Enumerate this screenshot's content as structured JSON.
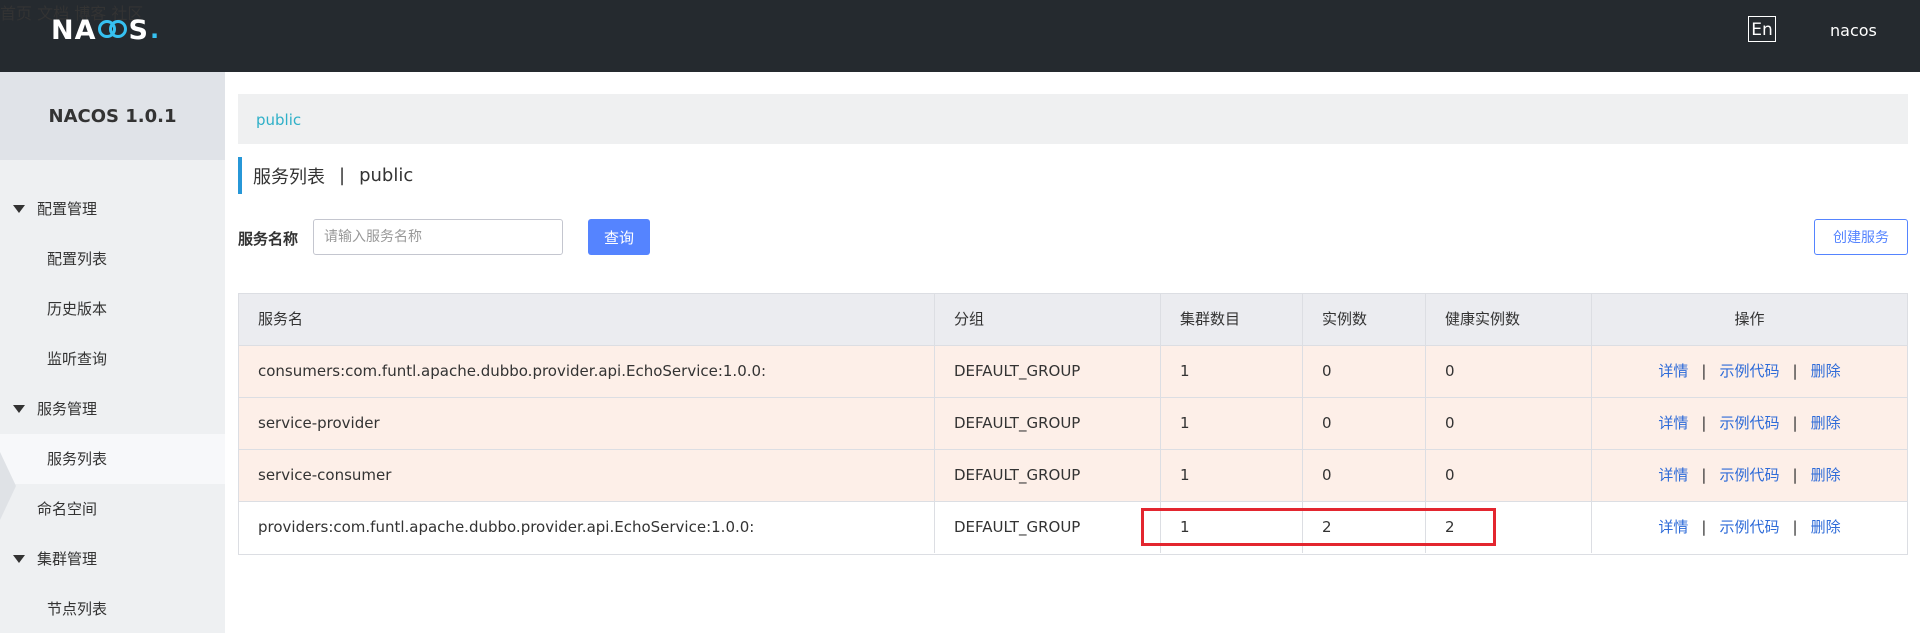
{
  "header": {
    "logo_text": "NACOS",
    "nav": [
      "首页",
      "文档",
      "博客",
      "社区"
    ],
    "lang": "En",
    "user": "nacos"
  },
  "sidebar": {
    "title": "NACOS 1.0.1",
    "items": [
      {
        "label": "配置管理"
      },
      {
        "label": "配置列表"
      },
      {
        "label": "历史版本"
      },
      {
        "label": "监听查询"
      },
      {
        "label": "服务管理"
      },
      {
        "label": "服务列表"
      },
      {
        "label": "命名空间"
      },
      {
        "label": "集群管理"
      },
      {
        "label": "节点列表"
      }
    ]
  },
  "namespace_bar": {
    "label": "public"
  },
  "heading": {
    "title": "服务列表",
    "separator": "|",
    "namespace": "public"
  },
  "filter": {
    "label": "服务名称",
    "placeholder": "请输入服务名称",
    "query_label": "查询",
    "create_label": "创建服务"
  },
  "table": {
    "columns": [
      "服务名",
      "分组",
      "集群数目",
      "实例数",
      "健康实例数",
      "操作"
    ],
    "rows": [
      {
        "name": "consumers:com.funtl.apache.dubbo.provider.api.EchoService:1.0.0:",
        "group": "DEFAULT_GROUP",
        "clusters": "1",
        "instances": "0",
        "healthy": "0"
      },
      {
        "name": "service-provider",
        "group": "DEFAULT_GROUP",
        "clusters": "1",
        "instances": "0",
        "healthy": "0"
      },
      {
        "name": "service-consumer",
        "group": "DEFAULT_GROUP",
        "clusters": "1",
        "instances": "0",
        "healthy": "0"
      },
      {
        "name": "providers:com.funtl.apache.dubbo.provider.api.EchoService:1.0.0:",
        "group": "DEFAULT_GROUP",
        "clusters": "1",
        "instances": "2",
        "healthy": "2"
      }
    ],
    "actions": {
      "detail": "详情",
      "sample_code": "示例代码",
      "delete": "删除",
      "separator": "|"
    }
  },
  "colors": {
    "topbar": "#252a2f",
    "accent": "#36c1f1",
    "primary": "#5584ff",
    "link": "#2e6bd8",
    "warning_row": "#fdefe8",
    "highlight": "#e3262f"
  }
}
